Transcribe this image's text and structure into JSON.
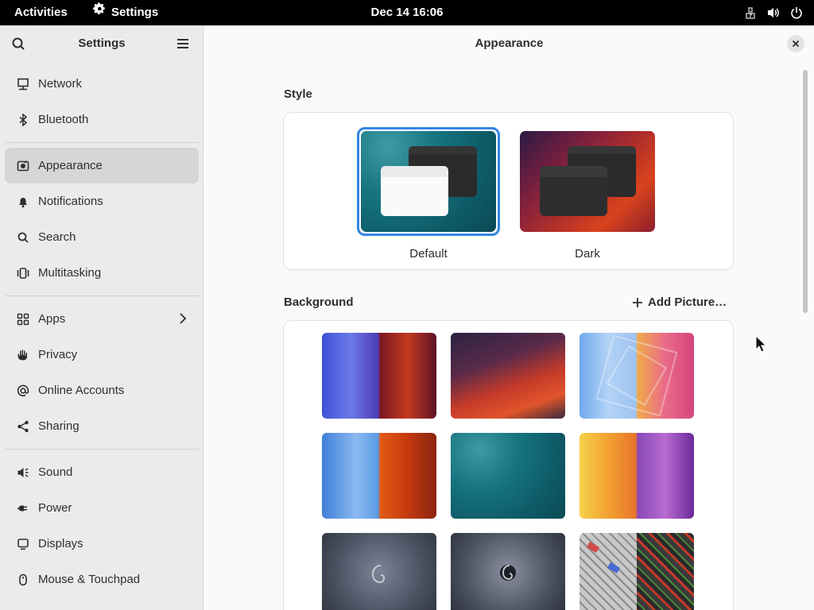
{
  "topbar": {
    "activities": "Activities",
    "app_name": "Settings",
    "clock": "Dec 14  16:06"
  },
  "sidebar": {
    "title": "Settings",
    "items": [
      {
        "label": "Network",
        "icon": "network-icon"
      },
      {
        "label": "Bluetooth",
        "icon": "bluetooth-icon"
      },
      {
        "label": "Appearance",
        "icon": "appearance-icon",
        "active": true
      },
      {
        "label": "Notifications",
        "icon": "bell-icon"
      },
      {
        "label": "Search",
        "icon": "search-icon"
      },
      {
        "label": "Multitasking",
        "icon": "multitasking-icon"
      },
      {
        "label": "Apps",
        "icon": "apps-grid-icon",
        "has_submenu": true
      },
      {
        "label": "Privacy",
        "icon": "hand-icon"
      },
      {
        "label": "Online Accounts",
        "icon": "at-sign-icon"
      },
      {
        "label": "Sharing",
        "icon": "share-icon"
      },
      {
        "label": "Sound",
        "icon": "speaker-icon"
      },
      {
        "label": "Power",
        "icon": "plug-icon"
      },
      {
        "label": "Displays",
        "icon": "monitor-icon"
      },
      {
        "label": "Mouse & Touchpad",
        "icon": "mouse-icon"
      }
    ]
  },
  "main": {
    "title": "Appearance",
    "style_section": {
      "label": "Style",
      "options": [
        {
          "label": "Default",
          "selected": true
        },
        {
          "label": "Dark",
          "selected": false
        }
      ]
    },
    "background_section": {
      "label": "Background",
      "add_button": "Add Picture…"
    }
  },
  "colors": {
    "accent": "#3584e4",
    "topbar": "#000000",
    "sidebar": "#ebebeb",
    "sidebar_active": "#d6d6d6"
  }
}
